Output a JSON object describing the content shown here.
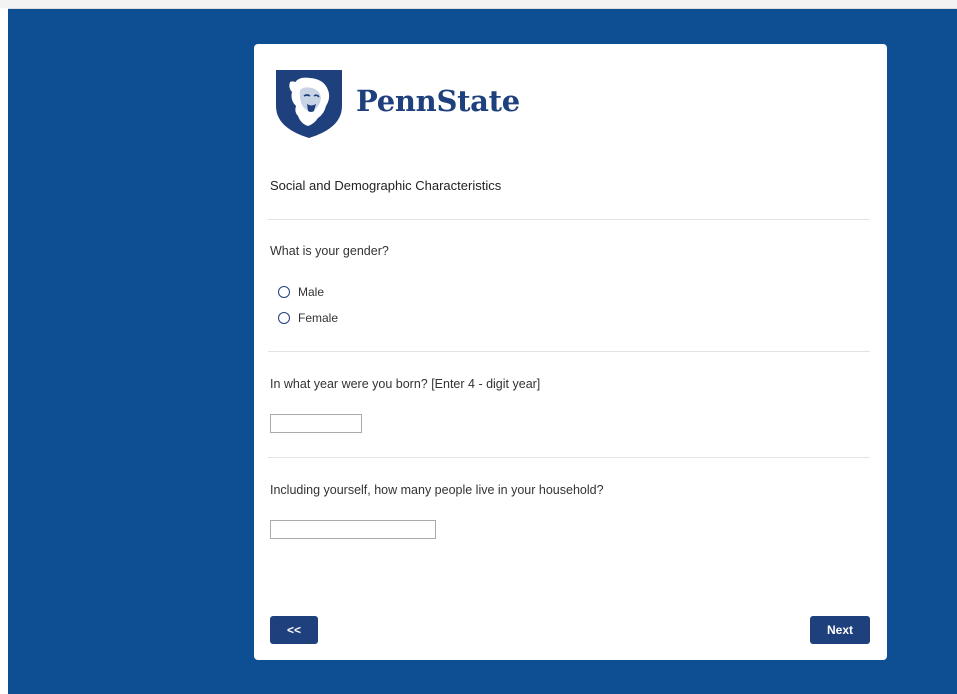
{
  "header": {
    "logo_text": "PennState"
  },
  "survey": {
    "section_title": "Social and Demographic Characteristics",
    "questions": [
      {
        "text": "What is your gender?",
        "options": [
          "Male",
          "Female"
        ]
      },
      {
        "text": "In what year were you born? [Enter 4 - digit year]",
        "value": ""
      },
      {
        "text": "Including yourself, how many people live in your household?",
        "value": ""
      }
    ]
  },
  "nav": {
    "prev_label": "<<",
    "next_label": "Next"
  },
  "colors": {
    "page_background": "#0e4f93",
    "brand": "#1e407c"
  },
  "icons": {
    "logo": "nittany-lion-shield-icon"
  }
}
